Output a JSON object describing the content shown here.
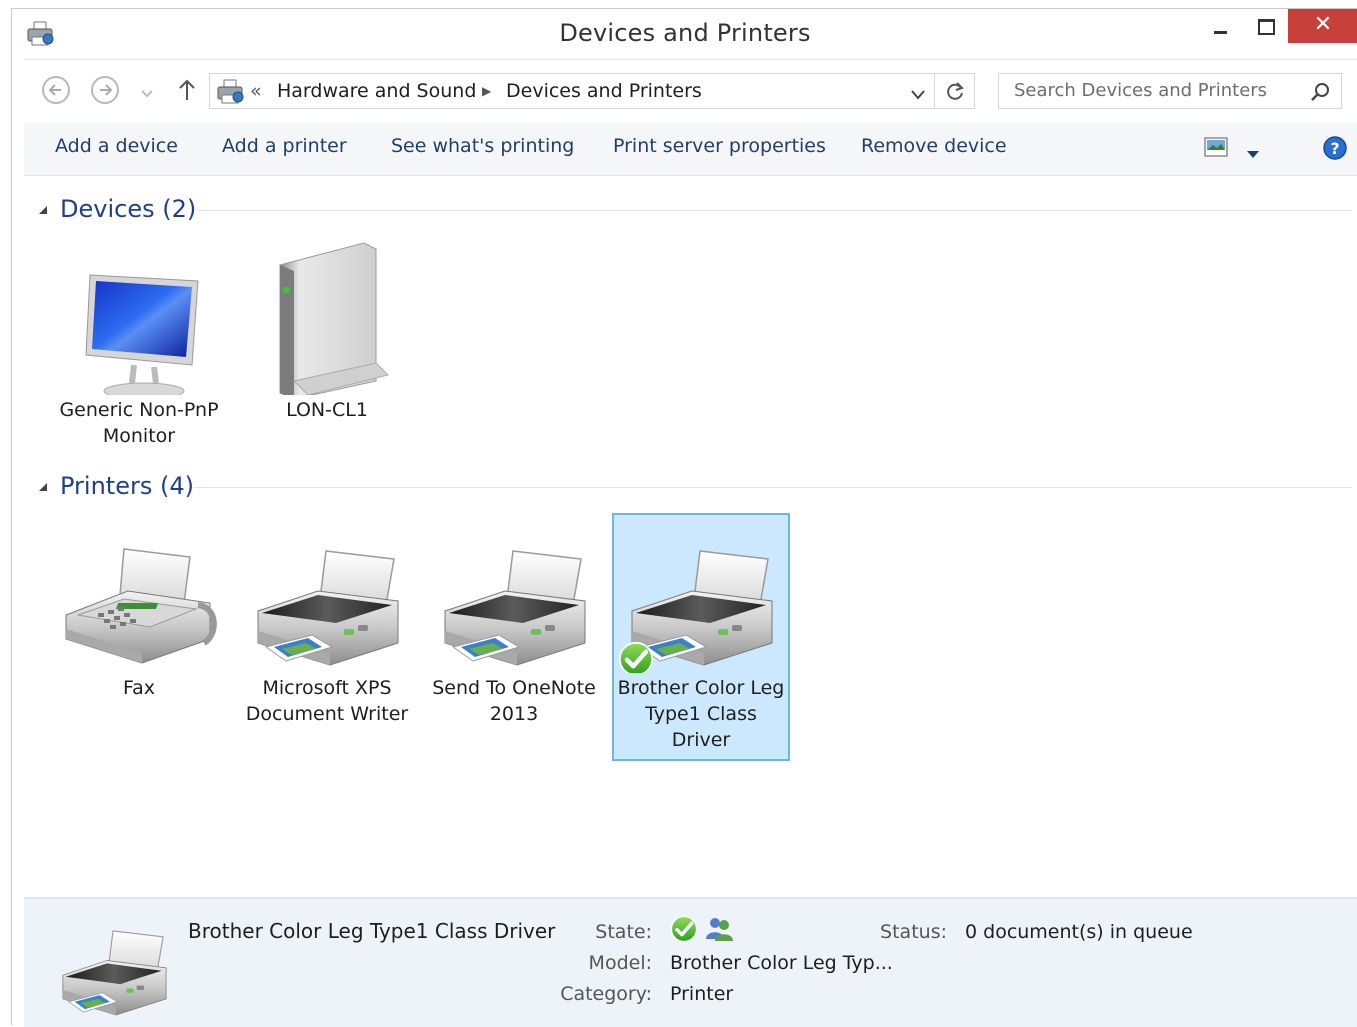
{
  "window": {
    "title": "Devices and Printers",
    "close_glyph": "✕"
  },
  "address": {
    "overflow": "«",
    "crumbs": [
      "Hardware and Sound",
      "Devices and Printers"
    ]
  },
  "search": {
    "placeholder": "Search Devices and Printers"
  },
  "toolbar": {
    "add_device": "Add a device",
    "add_printer": "Add a printer",
    "see_printing": "See what's printing",
    "print_server": "Print server properties",
    "remove_device": "Remove device"
  },
  "devices": {
    "label": "Devices (2)",
    "items": [
      {
        "name": "Generic Non-PnP Monitor",
        "icon": "monitor-icon"
      },
      {
        "name": "LON-CL1",
        "icon": "computer-tower-icon"
      }
    ]
  },
  "printers": {
    "label": "Printers (4)",
    "items": [
      {
        "name": "Fax",
        "icon": "fax-icon"
      },
      {
        "name": "Microsoft XPS Document Writer",
        "icon": "printer-icon"
      },
      {
        "name": "Send To OneNote 2013",
        "icon": "printer-icon"
      },
      {
        "name": "Brother Color Leg Type1 Class Driver",
        "icon": "printer-icon",
        "default": true,
        "selected": true
      }
    ]
  },
  "details": {
    "name": "Brother Color Leg Type1 Class Driver",
    "state_label": "State:",
    "model_label": "Model:",
    "model_value": "Brother Color Leg Typ...",
    "category_label": "Category:",
    "category_value": "Printer",
    "status_label": "Status:",
    "status_value": "0 document(s) in queue"
  },
  "colors": {
    "accent": "#1e3f8e",
    "selection": "#cce8ff",
    "close_button": "#c7413a"
  }
}
